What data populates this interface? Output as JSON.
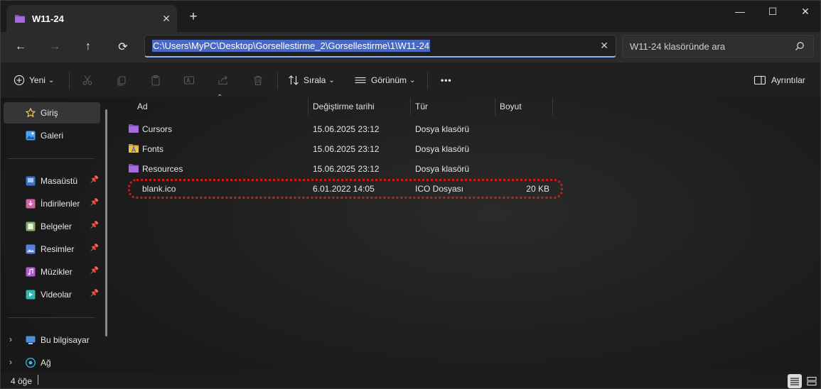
{
  "window": {
    "tab_title": "W11-24",
    "tab_close": "✕",
    "new_tab": "+",
    "minimize": "—",
    "maximize": "☐",
    "close": "✕"
  },
  "nav": {
    "back": "←",
    "forward": "→",
    "up": "↑",
    "refresh": "⟳",
    "address": "C:\\Users\\MyPC\\Desktop\\Gorsellestirme_2\\Gorsellestirme\\1\\W11-24",
    "address_clear": "✕",
    "search_placeholder": "W11-24 klasöründe ara"
  },
  "commandbar": {
    "new_label": "Yeni",
    "new_chevron": "⌄",
    "sort_label": "Sırala",
    "sort_chevron": "⌄",
    "view_label": "Görünüm",
    "view_chevron": "⌄",
    "more": "•••",
    "details_label": "Ayrıntılar"
  },
  "sidebar": {
    "top_items": [
      {
        "label": "Giriş",
        "icon": "star-icon",
        "color": "#f2c94c"
      },
      {
        "label": "Galeri",
        "icon": "gallery-icon",
        "color": "#4aa3f0"
      }
    ],
    "pinned": [
      {
        "label": "Masaüstü",
        "icon": "desktop-icon",
        "color": "#3d6fd1"
      },
      {
        "label": "İndirilenler",
        "icon": "downloads-icon",
        "color": "#d062a8"
      },
      {
        "label": "Belgeler",
        "icon": "documents-icon",
        "color": "#7fb06a"
      },
      {
        "label": "Resimler",
        "icon": "pictures-icon",
        "color": "#5a7fe0"
      },
      {
        "label": "Müzikler",
        "icon": "music-icon",
        "color": "#b05ad0"
      },
      {
        "label": "Videolar",
        "icon": "videos-icon",
        "color": "#2fb8b0"
      }
    ],
    "pin_glyph": "📌",
    "bottom_items": [
      {
        "label": "Bu bilgisayar",
        "icon": "computer-icon",
        "color": "#4a8fd8"
      },
      {
        "label": "Ağ",
        "icon": "network-icon",
        "color": "#3cb8e0"
      }
    ],
    "expand_glyph": "›"
  },
  "columns": {
    "name": "Ad",
    "date": "Değiştirme tarihi",
    "type": "Tür",
    "size": "Boyut",
    "sort_glyph": "⌃"
  },
  "files": [
    {
      "name": "Cursors",
      "date": "15.06.2025 23:12",
      "type": "Dosya klasörü",
      "size": "",
      "icon": "folder-icon",
      "color": "#8a4fc8"
    },
    {
      "name": "Fonts",
      "date": "15.06.2025 23:12",
      "type": "Dosya klasörü",
      "size": "",
      "icon": "fonts-folder-icon",
      "color": "#e8c04a"
    },
    {
      "name": "Resources",
      "date": "15.06.2025 23:12",
      "type": "Dosya klasörü",
      "size": "",
      "icon": "folder-icon",
      "color": "#8a4fc8"
    },
    {
      "name": "blank.ico",
      "date": "6.01.2022 14:05",
      "type": "ICO Dosyası",
      "size": "20 KB",
      "icon": "ico-file-icon",
      "color": ""
    }
  ],
  "status": {
    "count": "4 öğe"
  }
}
